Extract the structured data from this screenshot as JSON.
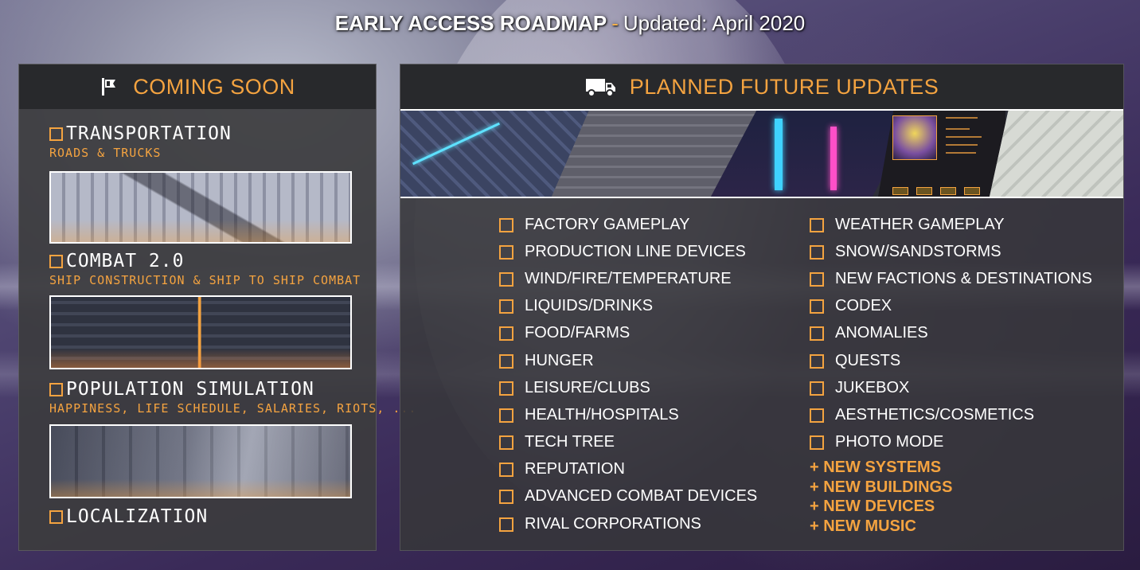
{
  "title": {
    "main": "EARLY ACCESS ROADMAP",
    "separator": "-",
    "updated": "Updated: April 2020"
  },
  "coming_soon": {
    "header": "COMING SOON",
    "icon": "flag-icon",
    "items": [
      {
        "label": "TRANSPORTATION",
        "subtitle": "ROADS & TRUCKS"
      },
      {
        "label": "COMBAT 2.0",
        "subtitle": "SHIP CONSTRUCTION & SHIP TO SHIP COMBAT"
      },
      {
        "label": "POPULATION SIMULATION",
        "subtitle": "HAPPINESS, LIFE SCHEDULE, SALARIES, RIOTS, ..."
      },
      {
        "label": "LOCALIZATION"
      }
    ]
  },
  "planned": {
    "header": "PLANNED FUTURE UPDATES",
    "icon": "truck-icon",
    "left_column": [
      "FACTORY GAMEPLAY",
      "PRODUCTION LINE DEVICES",
      "WIND/FIRE/TEMPERATURE",
      "LIQUIDS/DRINKS",
      "FOOD/FARMS",
      "HUNGER",
      "LEISURE/CLUBS",
      "HEALTH/HOSPITALS",
      "TECH TREE",
      "REPUTATION",
      "ADVANCED COMBAT DEVICES",
      "RIVAL CORPORATIONS"
    ],
    "right_column": [
      "WEATHER GAMEPLAY",
      "SNOW/SANDSTORMS",
      "NEW FACTIONS & DESTINATIONS",
      "CODEX",
      "ANOMALIES",
      "QUESTS",
      "JUKEBOX",
      "AESTHETICS/COSMETICS",
      "PHOTO MODE"
    ],
    "extras": [
      "+ NEW SYSTEMS",
      "+ NEW BUILDINGS",
      "+ NEW DEVICES",
      "+ NEW MUSIC"
    ]
  },
  "colors": {
    "accent": "#f4a340",
    "panel": "#3c3c3e",
    "header": "#28292c",
    "text": "#ffffff"
  }
}
